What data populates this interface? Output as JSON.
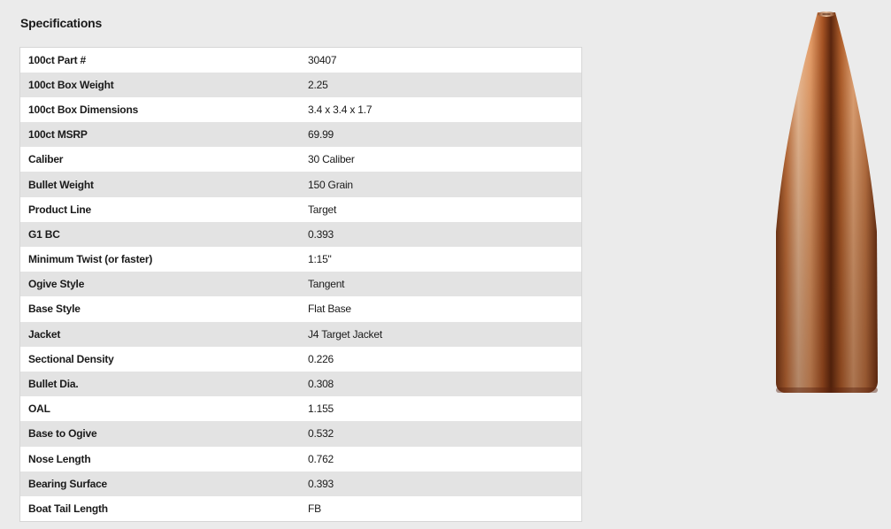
{
  "heading": "Specifications",
  "specs": [
    {
      "label": "100ct Part #",
      "value": "30407"
    },
    {
      "label": "100ct Box Weight",
      "value": "2.25"
    },
    {
      "label": "100ct Box Dimensions",
      "value": "3.4 x 3.4 x 1.7"
    },
    {
      "label": "100ct MSRP",
      "value": "69.99"
    },
    {
      "label": "Caliber",
      "value": "30 Caliber"
    },
    {
      "label": "Bullet Weight",
      "value": "150 Grain"
    },
    {
      "label": "Product Line",
      "value": "Target"
    },
    {
      "label": "G1 BC",
      "value": "0.393"
    },
    {
      "label": "Minimum Twist (or faster)",
      "value": "1:15\""
    },
    {
      "label": "Ogive Style",
      "value": "Tangent"
    },
    {
      "label": "Base Style",
      "value": "Flat Base"
    },
    {
      "label": "Jacket",
      "value": "J4 Target Jacket"
    },
    {
      "label": "Sectional Density",
      "value": "0.226"
    },
    {
      "label": "Bullet Dia.",
      "value": "0.308"
    },
    {
      "label": "OAL",
      "value": "1.155"
    },
    {
      "label": "Base to Ogive",
      "value": "0.532"
    },
    {
      "label": "Nose Length",
      "value": "0.762"
    },
    {
      "label": "Bearing Surface",
      "value": "0.393"
    },
    {
      "label": "Boat Tail Length",
      "value": "FB"
    }
  ],
  "colors": {
    "background": "#ebebeb",
    "row_odd": "#ffffff",
    "row_even": "#e3e3e3",
    "copper_light": "#f3c29a",
    "copper_mid": "#c8743e",
    "copper_dark": "#6b2f12"
  },
  "image": {
    "subject": "bullet-product-image"
  }
}
